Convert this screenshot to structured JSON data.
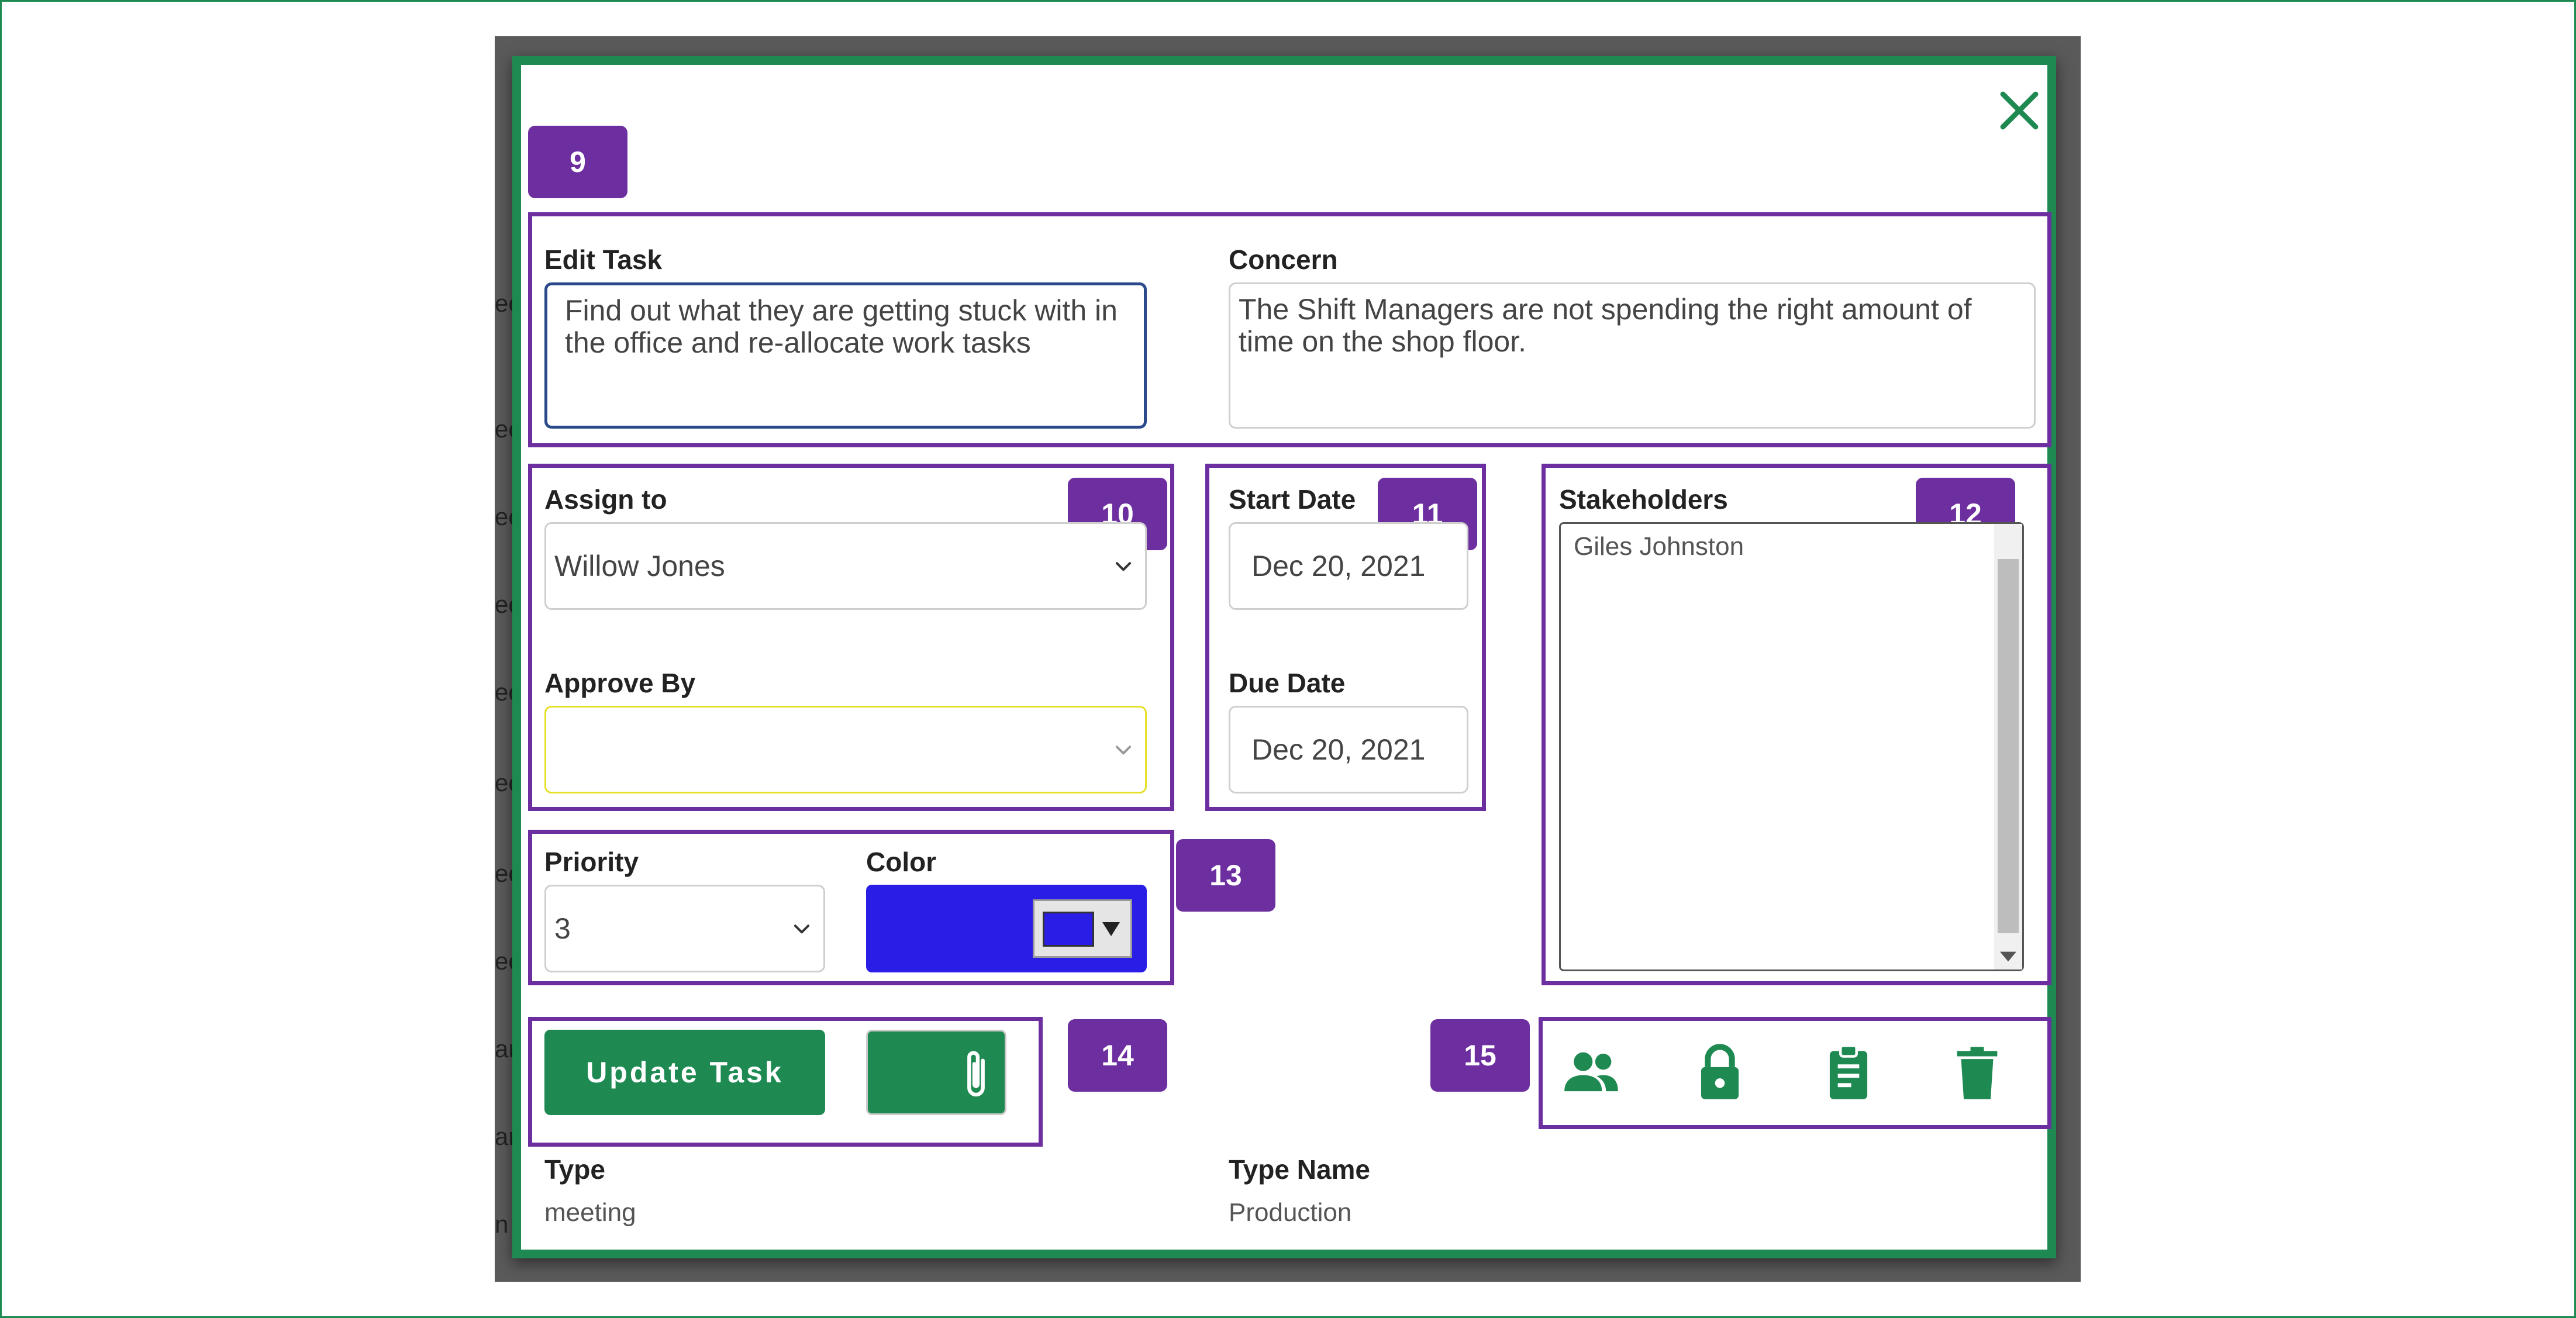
{
  "background_snippets": [
    "ec",
    "ec",
    "ec",
    "ec",
    "ec",
    "ec",
    "ec",
    "ec",
    "ar",
    "ar",
    "n"
  ],
  "badges": [
    "9",
    "10",
    "11",
    "12",
    "13",
    "14",
    "15"
  ],
  "edit_task": {
    "label": "Edit Task",
    "value": "Find out what they are getting stuck with in the office and re-allocate work tasks"
  },
  "concern": {
    "label": "Concern",
    "value": "The Shift Managers are not spending the right amount of time on the shop floor."
  },
  "assign_to": {
    "label": "Assign to",
    "value": "Willow Jones"
  },
  "approve_by": {
    "label": "Approve By",
    "value": ""
  },
  "start_date": {
    "label": "Start Date",
    "value": "Dec 20, 2021"
  },
  "due_date": {
    "label": "Due Date",
    "value": "Dec 20, 2021"
  },
  "stakeholders": {
    "label": "Stakeholders",
    "items": [
      "Giles Johnston"
    ]
  },
  "priority": {
    "label": "Priority",
    "value": "3"
  },
  "color": {
    "label": "Color",
    "value": "#2a1de6"
  },
  "buttons": {
    "update_task": "Update Task"
  },
  "type": {
    "label": "Type",
    "value": "meeting"
  },
  "type_name": {
    "label": "Type Name",
    "value": "Production"
  },
  "theme": {
    "accent": "#1e8a52",
    "badge": "#6d2fa0",
    "approve_border": "#e6e02a",
    "active_border": "#2b4a8c"
  },
  "icons": [
    "close-icon",
    "people-icon",
    "lock-icon",
    "clipboard-icon",
    "trash-icon",
    "paperclip-icon",
    "chevron-down-icon"
  ]
}
